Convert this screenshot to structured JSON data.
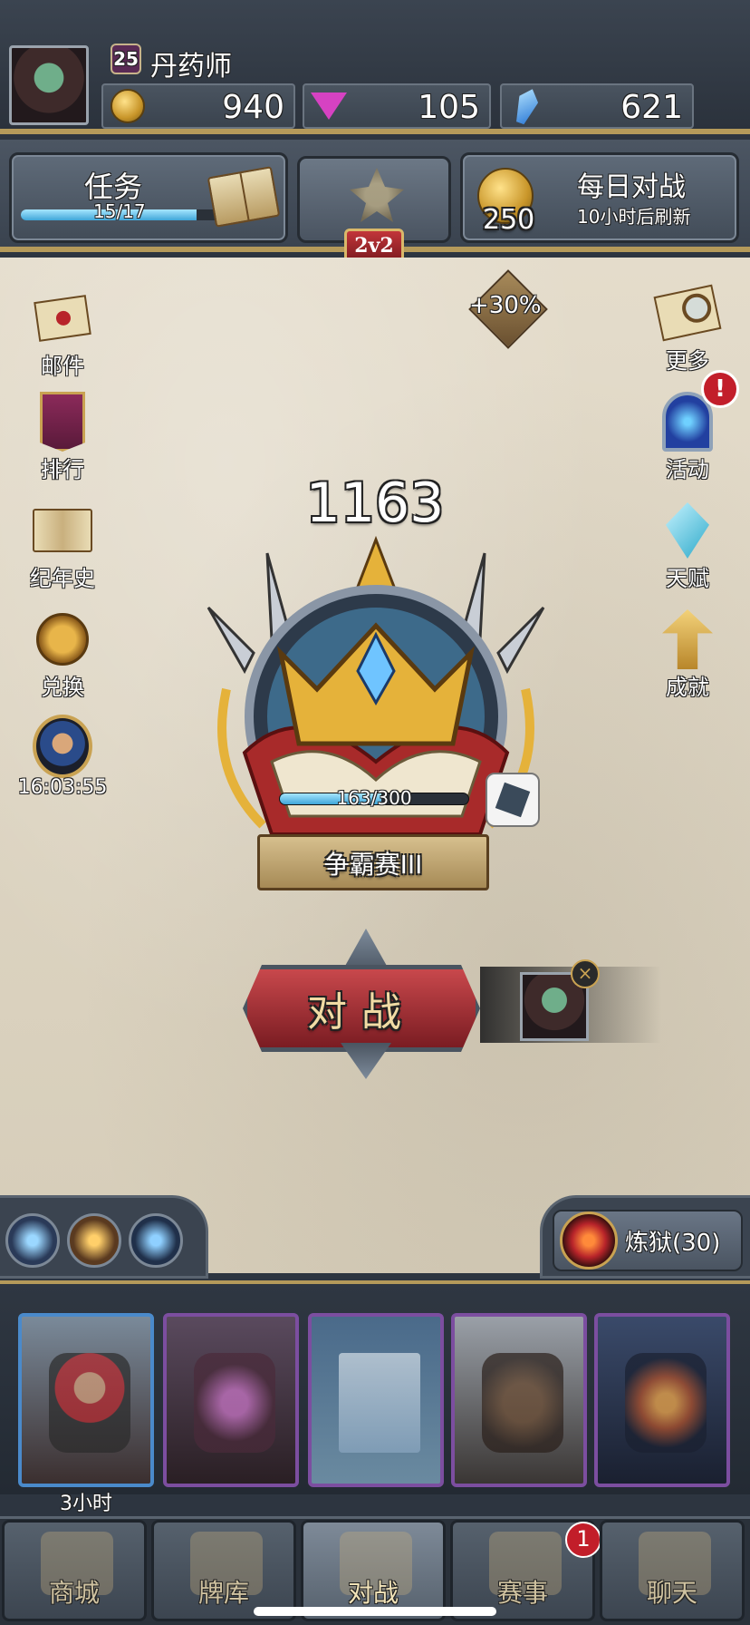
{
  "player": {
    "level": "25",
    "name": "丹药师"
  },
  "resources": {
    "gold": "940",
    "gems": "105",
    "crystals": "621"
  },
  "quest": {
    "title": "任务",
    "progress_text": "15/17",
    "progress_fraction": 0.88
  },
  "mode": {
    "label": "2v2"
  },
  "daily_battle": {
    "title": "每日对战",
    "reward": "250",
    "refresh_text": "10小时后刷新"
  },
  "bonus": "+30%",
  "left_menu": [
    {
      "label": "邮件",
      "icon": "mail-icon"
    },
    {
      "label": "排行",
      "icon": "banner-icon"
    },
    {
      "label": "纪年史",
      "icon": "book-icon"
    },
    {
      "label": "兑换",
      "icon": "medal-icon"
    },
    {
      "label": "16:03:55",
      "icon": "hero-portrait-icon"
    }
  ],
  "right_menu": [
    {
      "label": "更多",
      "icon": "magnifier-icon"
    },
    {
      "label": "活动",
      "icon": "portal-icon"
    },
    {
      "label": "天赋",
      "icon": "crystal-icon"
    },
    {
      "label": "成就",
      "icon": "arrow-up-icon"
    }
  ],
  "alert": "!",
  "rank": {
    "points": "1163",
    "progress_text": "163/300",
    "progress_fraction": 0.54,
    "tier": "争霸赛III"
  },
  "battle": {
    "label": "对战",
    "close": "×"
  },
  "purgatory": {
    "label": "炼狱(30)"
  },
  "cards": {
    "first_timer": "3小时"
  },
  "nav": {
    "shop": "商城",
    "deck": "牌库",
    "battle": "对战",
    "events": "赛事",
    "chat": "聊天",
    "events_badge": "1"
  },
  "colors": {
    "accent_gold": "#b59a5a",
    "battle_red": "#c8484c",
    "alert_red": "#c21e2a",
    "progress_blue": "#3fa6d8"
  }
}
